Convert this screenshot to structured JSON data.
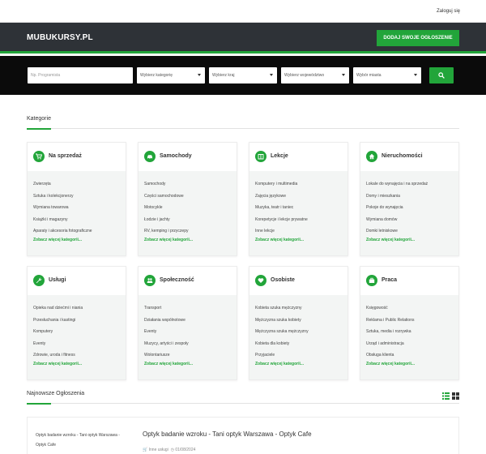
{
  "topbar": {
    "login": "Zaloguj się"
  },
  "header": {
    "logo": "MUBUKURSY.PL",
    "add_button": "DODAJ SWOJE OGŁOSZENIE"
  },
  "search": {
    "keyword_placeholder": "Np. Programista",
    "category": "Wybierz kategorię",
    "country": "Wybierz kraj",
    "region": "Wybierz województwo",
    "city": "Wybór miasta"
  },
  "categories_title": "Kategorie",
  "more_label": "Zobacz więcej kategorii...",
  "categories": [
    {
      "title": "Na sprzedaż",
      "icon": "cart-icon",
      "items": [
        "Zwierzęta",
        "Sztuka i kolekcjonerzy",
        "Wymiana towarowa",
        "Książki i magazyny",
        "Aparaty i akcesoria fotograficzne"
      ]
    },
    {
      "title": "Samochody",
      "icon": "car-icon",
      "items": [
        "Samochody",
        "Części samochodowe",
        "Motocykle",
        "Łodzie i jachty",
        "RV, kemping i przyczepy"
      ]
    },
    {
      "title": "Lekcje",
      "icon": "book-icon",
      "items": [
        "Komputery i multimedia",
        "Zajęcia językowe",
        "Muzyka, teatr i taniec",
        "Korepetycje i lekcje prywatne",
        "Inne lekcje"
      ]
    },
    {
      "title": "Nieruchomości",
      "icon": "home-icon",
      "items": [
        "Lokale do wynajęcia i na sprzedaż",
        "Domy i mieszkania",
        "Pokoje do wynajęcia",
        "Wymiana domów",
        "Domki letniskowe"
      ]
    },
    {
      "title": "Usługi",
      "icon": "wrench-icon",
      "items": [
        "Opieka nad dziećmi i niania",
        "Przesłuchania i kastingi",
        "Komputery",
        "Eventy",
        "Zdrowie, uroda i fitness"
      ]
    },
    {
      "title": "Społeczność",
      "icon": "people-icon",
      "items": [
        "Transport",
        "Działania wspólnotowe",
        "Eventy",
        "Muzycy, artyści i zespoły",
        "Wolontariusze"
      ]
    },
    {
      "title": "Osobiste",
      "icon": "heart-icon",
      "items": [
        "Kobieta szuka mężczyzny",
        "Mężczyzna szuka kobiety",
        "Mężczyzna szuka mężczyzny",
        "Kobieta dla kobiety",
        "Przyjaciele"
      ]
    },
    {
      "title": "Praca",
      "icon": "briefcase-icon",
      "items": [
        "Księgowość",
        "Reklama i Public Relations",
        "Sztuka, media i rozrywka",
        "Urząd i administracja",
        "Obsługa klienta"
      ]
    }
  ],
  "latest_title": "Najnowsze Ogłoszenia",
  "listing": {
    "image_alt": "Optyk badanie wzroku - Tani optyk Warszawa - Optyk Cafe",
    "title": "Optyk badanie wzroku - Tani optyk Warszawa - Optyk Cafe",
    "category": "Inne usługi",
    "date": "01/08/2024"
  },
  "colors": {
    "accent": "#22a53a",
    "header_bg": "#2e3237",
    "search_bg": "#0b0b0b"
  }
}
